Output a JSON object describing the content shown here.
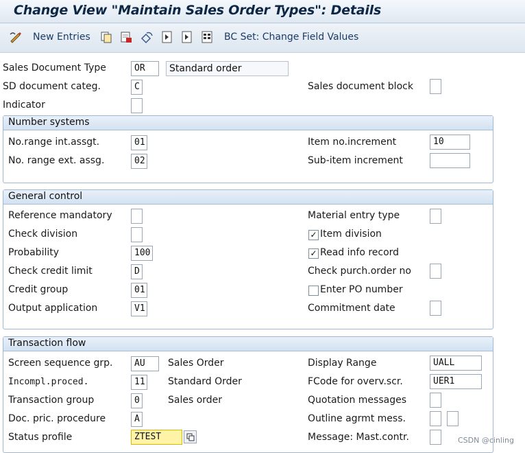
{
  "window": {
    "title": "Change View \"Maintain Sales Order Types\": Details"
  },
  "toolbar": {
    "new_entries": "New Entries",
    "bc_set": "BC Set: Change Field Values"
  },
  "header_fields": {
    "sales_document_type": {
      "label": "Sales Document Type",
      "value": "OR",
      "description": "Standard order"
    },
    "sd_document_categ": {
      "label": "SD document categ.",
      "value": "C"
    },
    "sales_document_block": {
      "label": "Sales document block",
      "value": ""
    },
    "indicator": {
      "label": "Indicator",
      "value": ""
    }
  },
  "number_systems": {
    "title": "Number systems",
    "no_range_int": {
      "label": "No.range int.assgt.",
      "value": "01"
    },
    "no_range_ext": {
      "label": "No. range ext. assg.",
      "value": "02"
    },
    "item_no_increment": {
      "label": "Item no.increment",
      "value": "10"
    },
    "sub_item_increment": {
      "label": "Sub-item increment",
      "value": ""
    }
  },
  "general_control": {
    "title": "General control",
    "reference_mandatory": {
      "label": "Reference mandatory",
      "value": ""
    },
    "check_division": {
      "label": "Check division",
      "value": ""
    },
    "probability": {
      "label": "Probability",
      "value": "100"
    },
    "check_credit_limit": {
      "label": "Check credit limit",
      "value": "D"
    },
    "credit_group": {
      "label": "Credit group",
      "value": "01"
    },
    "output_application": {
      "label": "Output application",
      "value": "V1"
    },
    "material_entry_type": {
      "label": "Material entry type",
      "value": ""
    },
    "item_division": {
      "label": "Item division",
      "checked": true
    },
    "read_info_record": {
      "label": "Read info record",
      "checked": true
    },
    "check_purch_order_no": {
      "label": "Check purch.order no",
      "value": ""
    },
    "enter_po_number": {
      "label": "Enter PO number",
      "checked": false
    },
    "commitment_date": {
      "label": "Commitment  date",
      "value": ""
    }
  },
  "transaction_flow": {
    "title": "Transaction flow",
    "screen_sequence_grp": {
      "label": "Screen sequence grp.",
      "value": "AU",
      "description": "Sales Order"
    },
    "incompl_proced": {
      "label": "Incompl.proced.",
      "value": "11",
      "description": "Standard Order"
    },
    "transaction_group": {
      "label": "Transaction group",
      "value": "0",
      "description": "Sales order"
    },
    "doc_pric_procedure": {
      "label": "Doc. pric. procedure",
      "value": "A"
    },
    "status_profile": {
      "label": "Status profile",
      "value": "ZTEST"
    },
    "display_range": {
      "label": "Display Range",
      "value": "UALL"
    },
    "fcode_overv_scr": {
      "label": "FCode for overv.scr.",
      "value": "UER1"
    },
    "quotation_messages": {
      "label": "Quotation messages",
      "value": ""
    },
    "outline_agrmt_mess": {
      "label": "Outline agrmt mess.",
      "value": ""
    },
    "message_mast_contr": {
      "label": "Message: Mast.contr.",
      "value": ""
    }
  },
  "watermark": "CSDN @cinling",
  "colors": {
    "section_border": "#9fb7d0",
    "section_header": "#d2e1f1",
    "highlight": "#fff3a8"
  }
}
